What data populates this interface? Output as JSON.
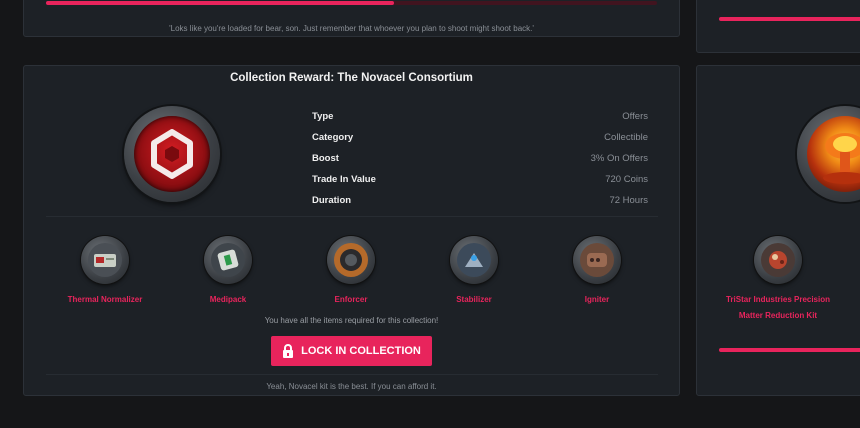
{
  "top_card": {
    "quote": "'Loks like you're loaded for bear, son. Just remember that whoever you plan to shoot might shoot back.'",
    "progress": 0.57
  },
  "collection": {
    "title": "Collection Reward: The Novacel Consortium",
    "badge_icon": "novacel-hexagon-icon",
    "stats": [
      {
        "label": "Type",
        "value": "Offers"
      },
      {
        "label": "Category",
        "value": "Collectible"
      },
      {
        "label": "Boost",
        "value": "3% On Offers"
      },
      {
        "label": "Trade In Value",
        "value": "720 Coins"
      },
      {
        "label": "Duration",
        "value": "72 Hours"
      }
    ],
    "items": [
      {
        "name": "Thermal Normalizer",
        "icon": "thermal-normalizer-icon"
      },
      {
        "name": "Medipack",
        "icon": "medipack-icon"
      },
      {
        "name": "Enforcer",
        "icon": "enforcer-icon"
      },
      {
        "name": "Stabilizer",
        "icon": "stabilizer-icon"
      },
      {
        "name": "Igniter",
        "icon": "igniter-icon"
      }
    ],
    "complete_message": "You have all the items required for this collection!",
    "lock_button_label": "LOCK IN COLLECTION",
    "footer_quote": "Yeah, Novacel kit is the best. If you can afford it."
  },
  "side_collection": {
    "badge_icon": "mushroom-cloud-icon",
    "item_name": "TriStar Industries Precision Matter Reduction Kit",
    "item_icon": "matter-reduction-kit-icon",
    "progress": 1.0
  },
  "colors": {
    "accent": "#e8245c",
    "panel": "#1d2126",
    "background": "#151618"
  }
}
